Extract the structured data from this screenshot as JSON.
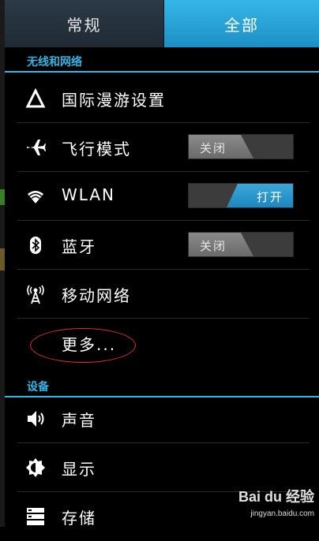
{
  "tabs": {
    "normal": "常规",
    "all": "全部"
  },
  "sections": {
    "wireless": "无线和网络",
    "device": "设备"
  },
  "items": {
    "roaming": "国际漫游设置",
    "airplane": "飞行模式",
    "wlan": "WLAN",
    "bluetooth": "蓝牙",
    "mobile": "移动网络",
    "more": "更多...",
    "sound": "声音",
    "display": "显示",
    "storage": "存储"
  },
  "toggles": {
    "airplane": {
      "state": "关闭"
    },
    "wlan": {
      "state": "打开"
    },
    "bluetooth": {
      "state": "关闭"
    }
  },
  "watermark": {
    "brand": "Bai du 经验",
    "url": "jingyan.baidu.com"
  },
  "colors": {
    "accent": "#33b5e5",
    "annotation": "#d93030"
  }
}
